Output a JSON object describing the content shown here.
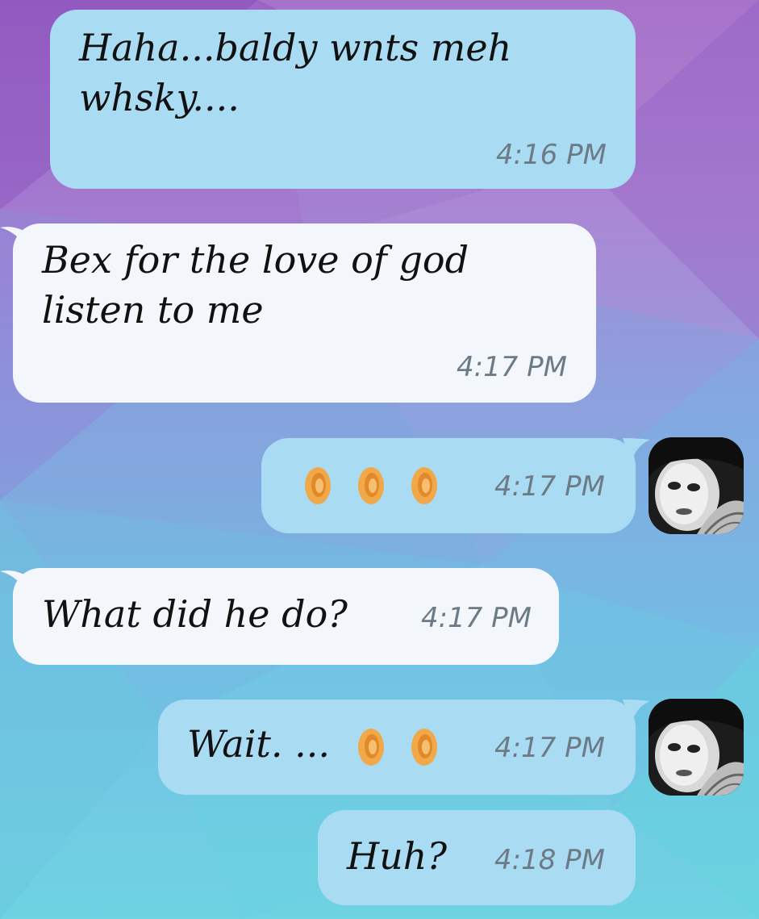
{
  "conversation": {
    "messages": [
      {
        "text_lines": [
          "Haha...baldy wnts meh",
          "whsky...."
        ],
        "time": "4:16 PM",
        "direction": "outgoing"
      },
      {
        "text_lines": [
          "Bex for the love of god",
          "listen to me"
        ],
        "time": "4:17 PM",
        "direction": "incoming"
      },
      {
        "text": "",
        "emoji": "ear",
        "emoji_count": 3,
        "time": "4:17 PM",
        "direction": "outgoing"
      },
      {
        "text": "What did he do?",
        "time": "4:17 PM",
        "direction": "incoming"
      },
      {
        "text": "Wait. ...",
        "emoji": "ear",
        "emoji_count": 2,
        "time": "4:17 PM",
        "direction": "outgoing"
      },
      {
        "text": "Huh?",
        "time": "4:18 PM",
        "direction": "outgoing"
      }
    ]
  },
  "colors": {
    "outgoing_bubble": "#a9dbf3",
    "incoming_bubble": "#f3f7fb",
    "timestamp": "#6c7b86"
  }
}
